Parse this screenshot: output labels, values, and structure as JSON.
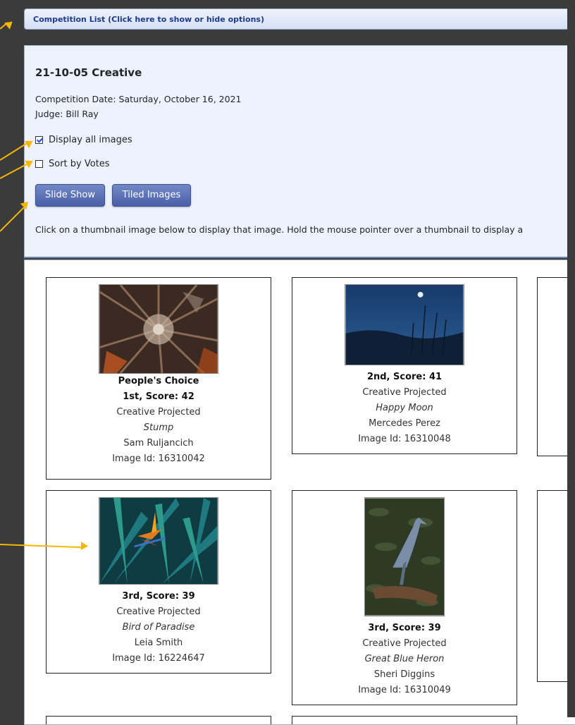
{
  "competition_bar": {
    "label": "Competition List (Click here to show or hide options)"
  },
  "competition": {
    "title": "21-10-05 Creative",
    "date_line": "Competition Date: Saturday, October 16, 2021",
    "judge_line": "Judge: Bill Ray"
  },
  "options": {
    "display_all": {
      "label": "Display all images",
      "checked": true
    },
    "sort_votes": {
      "label": "Sort by Votes",
      "checked": false
    }
  },
  "buttons": {
    "slide_show": "Slide Show",
    "tiled_images": "Tiled Images"
  },
  "instructions": "Click on a thumbnail image below to display that image. Hold the mouse pointer over a thumbnail to display a",
  "cards": [
    {
      "award": "People's Choice",
      "score": "1st, Score: 42",
      "category": "Creative Projected",
      "title": "Stump",
      "author": "Sam Ruljancich",
      "image_id": "Image Id: 16310042"
    },
    {
      "score": "2nd, Score: 41",
      "category": "Creative Projected",
      "title": "Happy Moon",
      "author": "Mercedes Perez",
      "image_id": "Image Id: 16310048"
    },
    {
      "score": "3rd, Score: 39",
      "category": "Creative Projected",
      "title": "Bird of Paradise",
      "author": "Leia Smith",
      "image_id": "Image Id: 16224647"
    },
    {
      "score": "3rd, Score: 39",
      "category": "Creative Projected",
      "title": "Great Blue Heron",
      "author": "Sheri Diggins",
      "image_id": "Image Id: 16310049"
    }
  ],
  "colors": {
    "accent": "#4a5fa8",
    "arrow": "#f5b800",
    "panel_bg": "#eef2fc",
    "page_bg": "#3b3b3b"
  }
}
